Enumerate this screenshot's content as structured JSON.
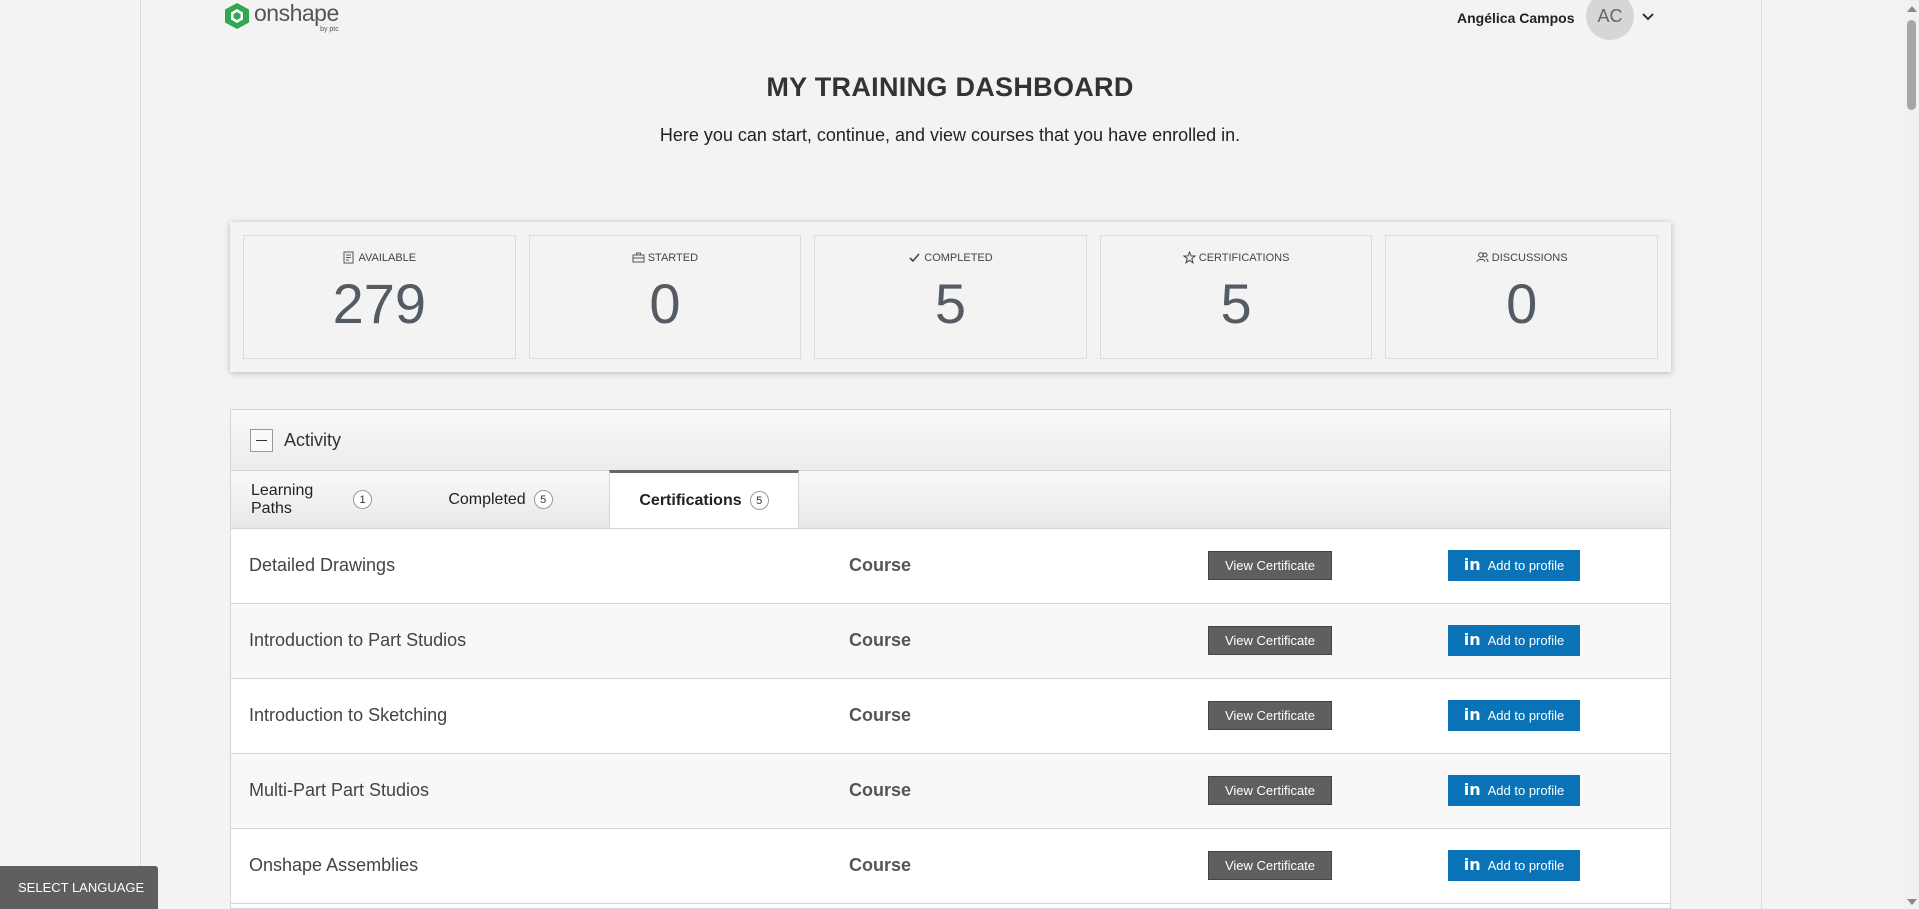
{
  "header": {
    "logo_word": "onshape",
    "logo_sub": "by ptc",
    "user_name": "Angélica Campos",
    "avatar_initials": "AC"
  },
  "page": {
    "title": "MY TRAINING DASHBOARD",
    "subtitle": "Here you can start, continue, and view courses that you have enrolled in."
  },
  "stats": [
    {
      "label": "AVAILABLE",
      "value": "279",
      "icon": "catalog-icon"
    },
    {
      "label": "STARTED",
      "value": "0",
      "icon": "briefcase-icon"
    },
    {
      "label": "COMPLETED",
      "value": "5",
      "icon": "check-icon"
    },
    {
      "label": "CERTIFICATIONS",
      "value": "5",
      "icon": "star-icon"
    },
    {
      "label": "DISCUSSIONS",
      "value": "0",
      "icon": "people-icon"
    }
  ],
  "activity": {
    "title": "Activity",
    "tabs": [
      {
        "label": "Learning Paths",
        "count": "1"
      },
      {
        "label": "Completed",
        "count": "5"
      },
      {
        "label": "Certifications",
        "count": "5"
      }
    ],
    "active_tab": "Certifications",
    "rows": [
      {
        "title": "Detailed Drawings",
        "type": "Course"
      },
      {
        "title": "Introduction to Part Studios",
        "type": "Course"
      },
      {
        "title": "Introduction to Sketching",
        "type": "Course"
      },
      {
        "title": "Multi-Part Part Studios",
        "type": "Course"
      },
      {
        "title": "Onshape Assemblies",
        "type": "Course"
      }
    ],
    "view_certificate_label": "View Certificate",
    "add_to_profile_label": "Add to profile",
    "linkedin_glyph": "in"
  },
  "footer": {
    "select_language": "SELECT LANGUAGE"
  },
  "colors": {
    "brand_green": "#2fa84f",
    "linkedin_blue": "#0a73b7",
    "button_gray": "#5f5f5f"
  }
}
